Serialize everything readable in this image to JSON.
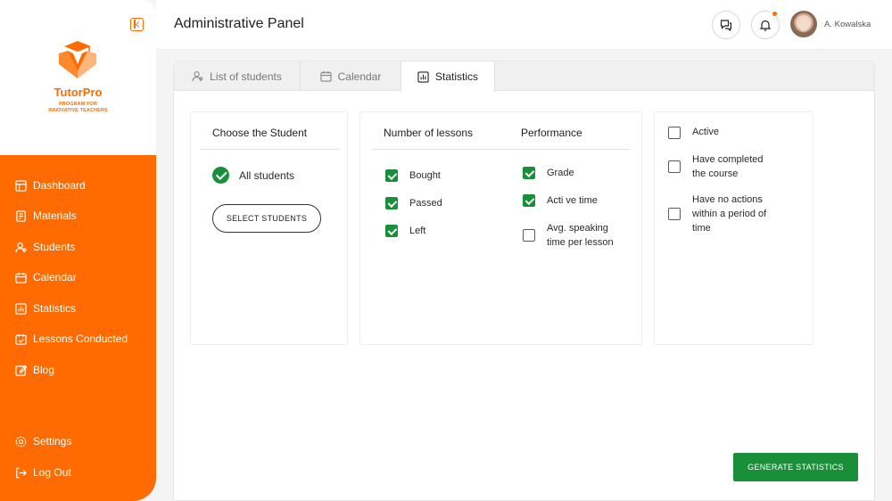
{
  "app": {
    "brand_name": "TutorPro",
    "brand_tagline_line1": "PROGRAM FOR",
    "brand_tagline_line2": "INNOVATIVE TEACHERS"
  },
  "header": {
    "title": "Administrative Panel",
    "user_name": "A. Kowalska"
  },
  "sidebar": {
    "items": [
      {
        "label": "Dashboard",
        "icon": "dashboard-icon"
      },
      {
        "label": "Materials",
        "icon": "materials-icon"
      },
      {
        "label": "Students",
        "icon": "students-icon"
      },
      {
        "label": "Calendar",
        "icon": "calendar-icon"
      },
      {
        "label": "Statistics",
        "icon": "statistics-icon"
      },
      {
        "label": "Lessons Conducted",
        "icon": "lessons-icon"
      },
      {
        "label": "Blog",
        "icon": "blog-icon"
      }
    ],
    "bottom_items": [
      {
        "label": "Settings",
        "icon": "gear-icon"
      },
      {
        "label": "Log Out",
        "icon": "logout-icon"
      }
    ]
  },
  "tabs": [
    {
      "label": "List of students",
      "icon": "students-icon",
      "active": false
    },
    {
      "label": "Calendar",
      "icon": "calendar-icon",
      "active": false
    },
    {
      "label": "Statistics",
      "icon": "statistics-icon",
      "active": true
    }
  ],
  "student_card": {
    "heading": "Choose the Student",
    "all_students": "All students",
    "select_button": "SELECT STUDENTS"
  },
  "lessons_card": {
    "heading_lessons": "Number of lessons",
    "heading_performance": "Performance",
    "lessons_options": [
      {
        "label": "Bought",
        "checked": true
      },
      {
        "label": "Passed",
        "checked": true
      },
      {
        "label": "Left",
        "checked": true
      }
    ],
    "performance_options": [
      {
        "label": "Grade",
        "checked": true
      },
      {
        "label": "Acti ve time",
        "checked": true
      },
      {
        "label_line1": "Avg. speaking",
        "label_line2": "time per lesson",
        "checked": false
      }
    ]
  },
  "filter_card": {
    "options": [
      {
        "label": "Active",
        "checked": false
      },
      {
        "label_line1": "Have completed",
        "label_line2": "the course",
        "checked": false
      },
      {
        "label_line1": "Have no actions",
        "label_line2": "within a period of",
        "label_line3": "time",
        "checked": false
      }
    ]
  },
  "actions": {
    "generate_label": "GENERATE STATISTICS"
  },
  "colors": {
    "brand_orange": "#ff6b00",
    "check_green": "#1a8f3a"
  }
}
